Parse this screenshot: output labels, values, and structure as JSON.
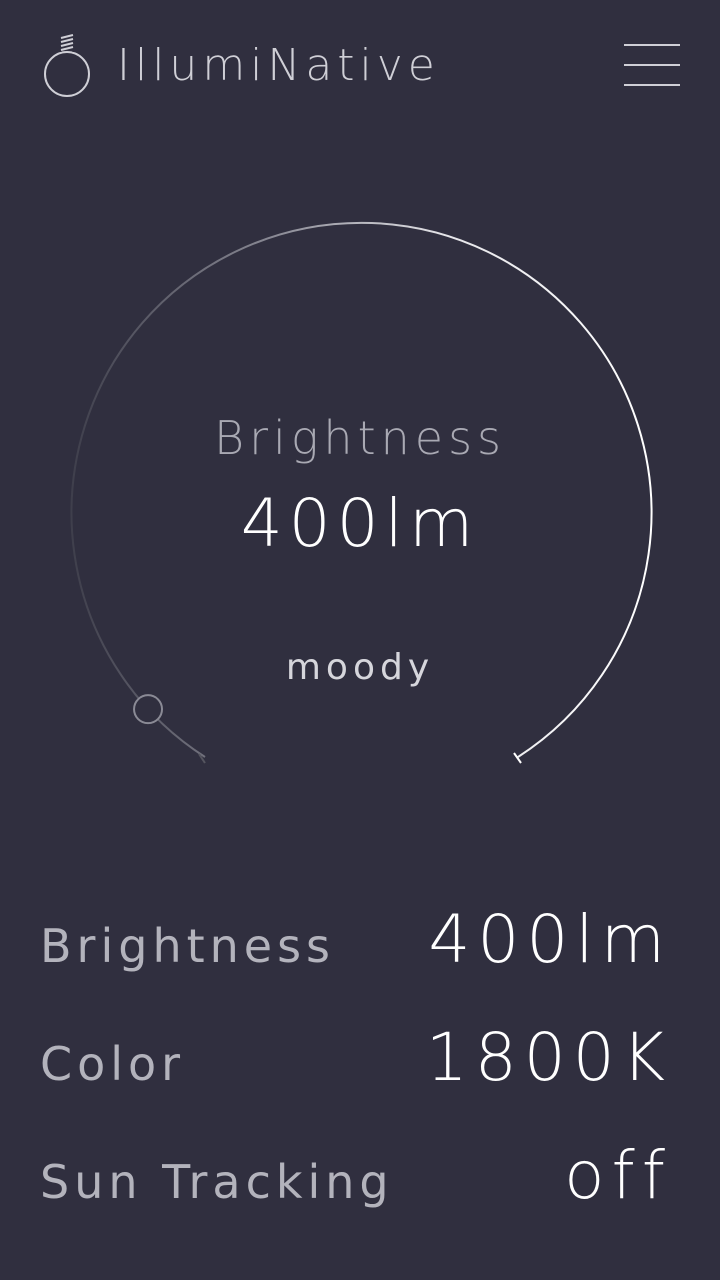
{
  "app": {
    "title": "IllumiNative",
    "logo_icon": "lightbulb-icon",
    "menu_icon": "hamburger-menu-icon"
  },
  "dial": {
    "title": "Brightness",
    "value": "400lm",
    "mood": "moody",
    "level_fraction": 0.05,
    "track_color": "#ffffff",
    "track_faded_color": "#4a4a55"
  },
  "settings": [
    {
      "label": "Brightness",
      "value": "400lm"
    },
    {
      "label": "Color",
      "value": "1800K"
    },
    {
      "label": "Sun Tracking",
      "value": "off"
    }
  ],
  "colors": {
    "background": "#302f3f",
    "text_primary": "#ffffff",
    "text_secondary": "#b3b3bc"
  }
}
